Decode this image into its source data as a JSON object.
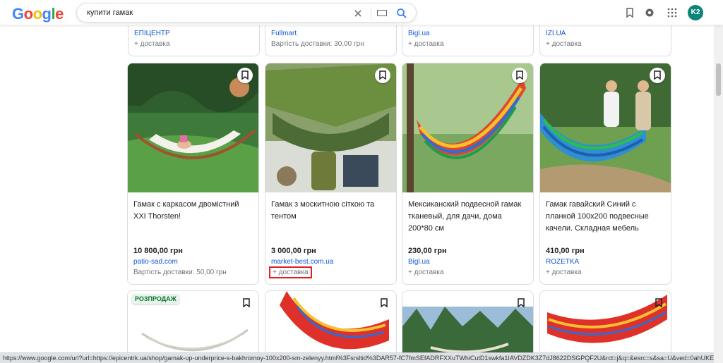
{
  "header": {
    "logo_letters": [
      "G",
      "o",
      "o",
      "g",
      "l",
      "e"
    ],
    "search_value": "купити гамак",
    "avatar_initials": "K2"
  },
  "top_row": [
    {
      "price": "",
      "store": "ЕПІЦЕНТР",
      "shipping": "+ доставка"
    },
    {
      "price": "",
      "store": "Fullmart",
      "shipping": "Вартість доставки: 30,00 грн"
    },
    {
      "price": "",
      "store": "Bigl.ua",
      "shipping": "+ доставка"
    },
    {
      "price": "",
      "store": "IZI.UA",
      "shipping": "+ доставка"
    }
  ],
  "products": [
    {
      "title": "Гамак с каркасом двомістний XXI Thorsten!",
      "price": "10 800,00 грн",
      "store": "patio-sad.com",
      "shipping": "Вартість доставки: 50,00 грн"
    },
    {
      "title": "Гамак з москитною сіткою та тентом",
      "price": "3 000,00 грн",
      "store": "market-best.com.ua",
      "shipping": "+ доставка"
    },
    {
      "title": "Мексиканский подвесной гамак тканевый, для дачи, дома 200*80 см",
      "price": "230,00 грн",
      "store": "Bigl.ua",
      "shipping": "+ доставка"
    },
    {
      "title": "Гамак гавайский Синий с планкой 100х200 подвесные качели. Складная мебель",
      "price": "410,00 грн",
      "store": "ROZETKA",
      "shipping": "+ доставка"
    }
  ],
  "bottom_row": {
    "sale_badge": "РОЗПРОДАЖ"
  },
  "colors": {
    "accent_link": "#1558d6",
    "highlight": "#e02020",
    "avatar": "#0b8479"
  },
  "status_url": "https://www.google.com/url?url=https://epicentrk.ua/shop/gamak-up-underprice-s-bakhromoy-100x200-sm-zelenyy.html%3Fsrsltid%3DAR57-fC7fmSEfADRFXXuTWhiCutD1swkfa1IAVDZDK3Z7dJ8622DSGPQF2U&rct=j&q=&esrc=s&sa=U&ved=0ahUKEwiRv..."
}
